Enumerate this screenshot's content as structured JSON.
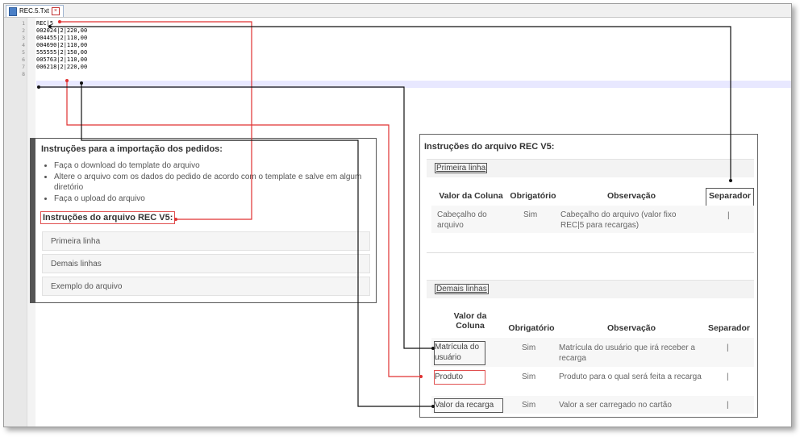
{
  "editor": {
    "tab_label": "REC.5.Txt",
    "line_numbers": [
      "1",
      "2",
      "3",
      "4",
      "5",
      "6",
      "7",
      "8"
    ],
    "lines": [
      "REC|5",
      "002024|2|220,00",
      "004455|2|110,00",
      "004690|2|110,00",
      "555555|2|150,00",
      "005763|2|110,00",
      "006218|2|220,00",
      ""
    ]
  },
  "left_panel": {
    "title": "Instruções para a importação dos pedidos:",
    "steps": [
      "Faça o download do template do arquivo",
      "Altere o arquivo com os dados do pedido de acordo com o template e salve em algum diretório",
      "Faça o upload do arquivo"
    ],
    "subtitle": "Instruções do arquivo REC V5:",
    "accordions": [
      "Primeira linha",
      "Demais linhas",
      "Exemplo do arquivo"
    ]
  },
  "right_panel": {
    "title": "Instruções do arquivo REC V5:",
    "section1": {
      "label": "Primeira linha",
      "headers": [
        "Valor da Coluna",
        "Obrigatório",
        "Observação",
        "Separador"
      ],
      "row": [
        "Cabeçalho do arquivo",
        "Sim",
        "Cabeçalho do arquivo (valor fixo REC|5 para recargas)",
        "|"
      ]
    },
    "section2": {
      "label": "Demais linhas",
      "headers": [
        "Valor da Coluna",
        "Obrigatório",
        "Observação",
        "Separador"
      ],
      "rows": [
        [
          "Matrícula do usuário",
          "Sim",
          "Matrícula do usuário que irá receber a recarga",
          "|"
        ],
        [
          "Produto",
          "Sim",
          "Produto para o qual será feita a recarga",
          "|"
        ],
        [
          "Valor da recarga",
          "Sim",
          "Valor a ser carregado no cartão",
          "|"
        ]
      ]
    }
  },
  "colors": {
    "arrow_red": "#e03030",
    "arrow_black": "#111111"
  }
}
